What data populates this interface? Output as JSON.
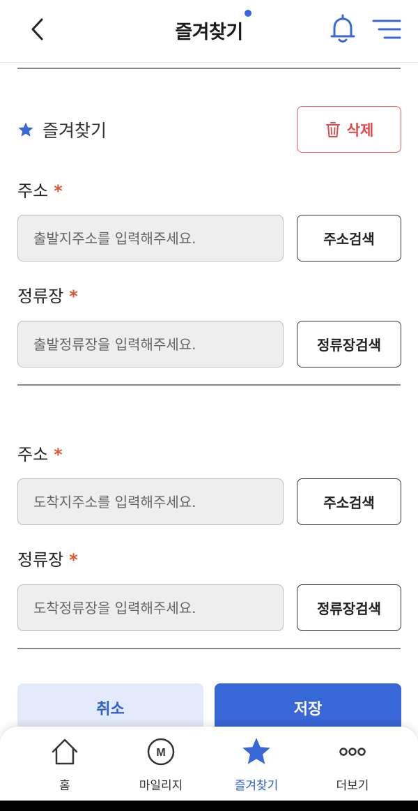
{
  "header": {
    "title": "즐겨찾기"
  },
  "favorite": {
    "section_title": "즐겨찾기",
    "delete_label": "삭제"
  },
  "origin": {
    "address_label": "주소",
    "address_placeholder": "출발지주소를 입력해주세요.",
    "address_search_label": "주소검색",
    "stop_label": "정류장",
    "stop_placeholder": "출발정류장을 입력해주세요.",
    "stop_search_label": "정류장검색"
  },
  "destination": {
    "address_label": "주소",
    "address_placeholder": "도착지주소를 입력해주세요.",
    "address_search_label": "주소검색",
    "stop_label": "정류장",
    "stop_placeholder": "도착정류장을 입력해주세요.",
    "stop_search_label": "정류장검색"
  },
  "required_mark": "*",
  "actions": {
    "cancel_label": "취소",
    "save_label": "저장"
  },
  "bottom_nav": {
    "items": [
      {
        "label": "홈",
        "icon": "home-icon"
      },
      {
        "label": "마일리지",
        "icon": "mileage-icon"
      },
      {
        "label": "즐겨찾기",
        "icon": "star-icon",
        "active": true
      },
      {
        "label": "더보기",
        "icon": "more-icon"
      }
    ],
    "mileage_icon_letter": "M"
  },
  "colors": {
    "accent": "#3867d8",
    "danger": "#e54848",
    "required": "#e0532f",
    "cancel_bg": "#e3ebfb"
  }
}
